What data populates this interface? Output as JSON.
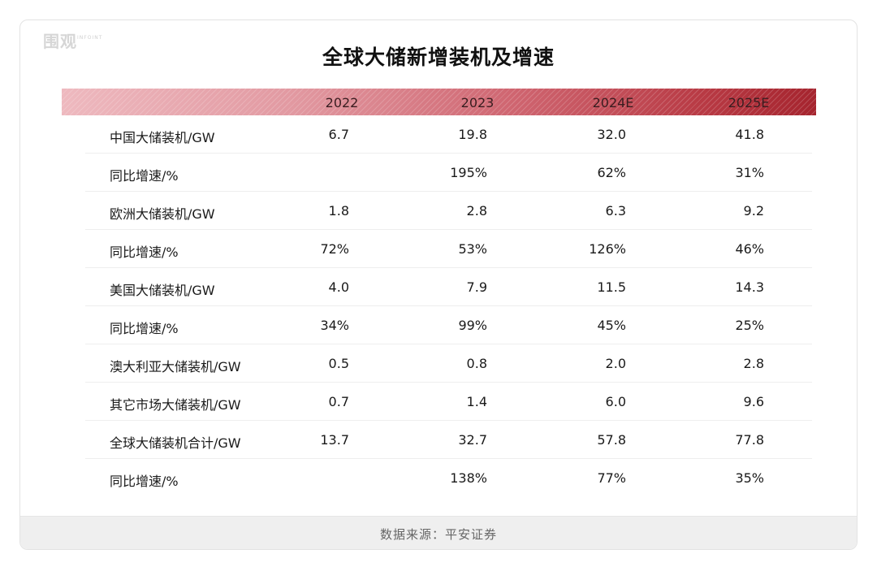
{
  "watermark": {
    "cn": "围观",
    "en": "INFOINT"
  },
  "chart_data": {
    "type": "table",
    "title": "全球大储新增装机及增速",
    "columns": [
      "2022",
      "2023",
      "2024E",
      "2025E"
    ],
    "rows": [
      {
        "label": "中国大储装机/GW",
        "values": [
          "6.7",
          "19.8",
          "32.0",
          "41.8"
        ]
      },
      {
        "label": "同比增速/%",
        "values": [
          "",
          "195%",
          "62%",
          "31%"
        ]
      },
      {
        "label": "欧洲大储装机/GW",
        "values": [
          "1.8",
          "2.8",
          "6.3",
          "9.2"
        ]
      },
      {
        "label": "同比增速/%",
        "values": [
          "72%",
          "53%",
          "126%",
          "46%"
        ]
      },
      {
        "label": "美国大储装机/GW",
        "values": [
          "4.0",
          "7.9",
          "11.5",
          "14.3"
        ]
      },
      {
        "label": "同比增速/%",
        "values": [
          "34%",
          "99%",
          "45%",
          "25%"
        ]
      },
      {
        "label": "澳大利亚大储装机/GW",
        "values": [
          "0.5",
          "0.8",
          "2.0",
          "2.8"
        ]
      },
      {
        "label": "其它市场大储装机/GW",
        "values": [
          "0.7",
          "1.4",
          "6.0",
          "9.6"
        ]
      },
      {
        "label": "全球大储装机合计/GW",
        "values": [
          "13.7",
          "32.7",
          "57.8",
          "77.8"
        ]
      },
      {
        "label": "同比增速/%",
        "values": [
          "",
          "138%",
          "77%",
          "35%"
        ]
      }
    ],
    "source": "数据来源：平安证券"
  }
}
